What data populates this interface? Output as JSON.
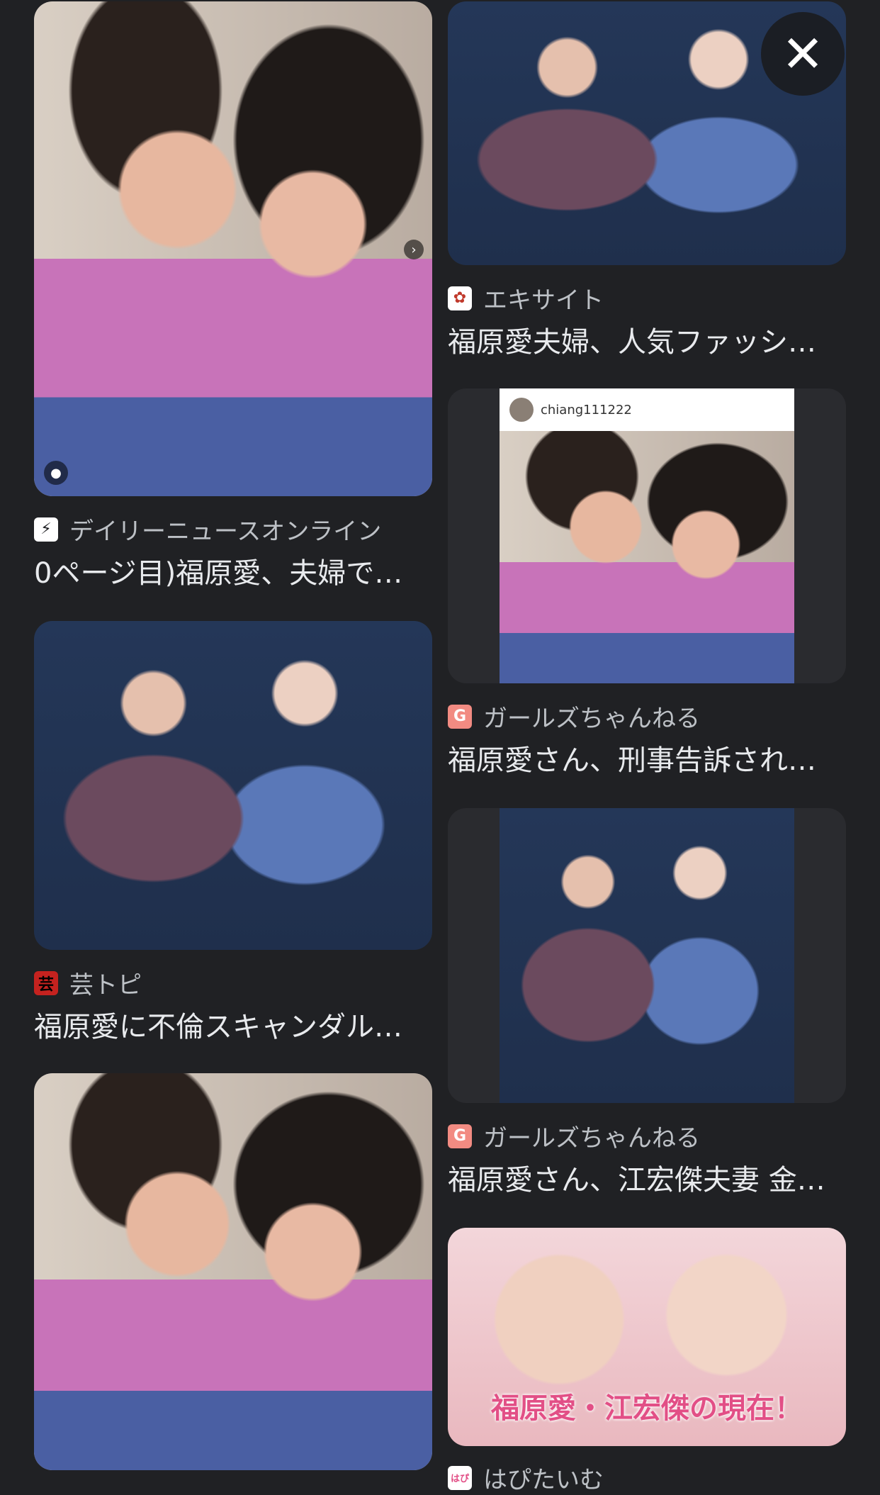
{
  "results": [
    {
      "source": "デイリーニュースオンライン",
      "title": "0ページ目)福原愛、夫婦で…",
      "favicon_icon": "lightning-icon"
    },
    {
      "source": "エキサイト",
      "title": "福原愛夫婦、人気ファッシ…",
      "favicon_icon": "excite-icon"
    },
    {
      "source": "ガールズちゃんねる",
      "title": "福原愛さん、刑事告訴され…",
      "favicon_icon": "g-icon",
      "favicon_text": "G",
      "photo_caption": "chiang111222"
    },
    {
      "source": "芸トピ",
      "title": "福原愛に不倫スキャンダル…",
      "favicon_icon": "geitopi-icon",
      "favicon_text": "芸"
    },
    {
      "source": "ガールズちゃんねる",
      "title": "福原愛さん、江宏傑夫妻 金…",
      "favicon_icon": "g-icon",
      "favicon_text": "G"
    },
    {
      "source": "はぴたいむ",
      "favicon_icon": "hapitime-icon",
      "favicon_text": "はぴ",
      "overlay_text": "福原愛・江宏傑の現在！"
    }
  ],
  "colors": {
    "background": "#202124",
    "text": "#e8eaed",
    "source_text": "#bdc1c6",
    "g_badge": "#f28b82"
  }
}
